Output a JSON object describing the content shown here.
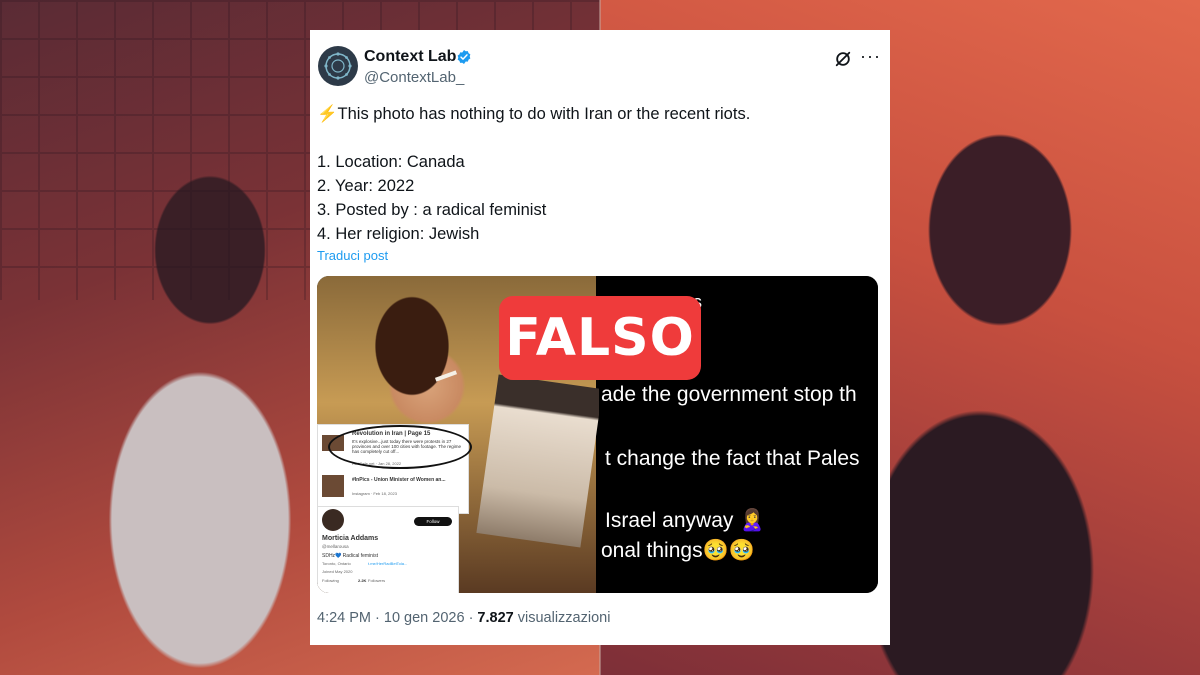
{
  "tweet": {
    "author_name": "Context Lab",
    "handle": "@ContextLab_",
    "verified_icon": "verified-badge-icon",
    "lines": [
      "⚡This photo has nothing to do with Iran or the recent riots.",
      "1. Location:  Canada",
      "2. Year:   2022",
      "3. Posted by :  a radical feminist",
      "4. Her religion:  Jewish"
    ],
    "translate_link": "Traduci post",
    "time": "4:24 PM",
    "date": "10 gen 2026",
    "views_count": "7.827",
    "views_label": "visualizzazioni"
  },
  "media_right": {
    "lines": [
      "ms",
      "ade the government stop th",
      "t change the fact that Pales",
      "Israel anyway 🙎‍♀️",
      "onal things🥹🥹"
    ]
  },
  "media_left": {
    "post1_title": "Revolution in Iran | Page 15",
    "post1_text": "It's explosive...just today there were protests in 27 provinces and over 100 cities with footage. The regime has completely cut off...",
    "post1_meta": "RedCafe.net · Jan 28, 2022",
    "post2_text": "#InPics - Union Minister of Women an...",
    "post2_meta": "Instagram · Feb 18, 2023",
    "profile_name": "Morticia Addams",
    "profile_handle": "@mellarousa",
    "profile_bio": "SDHz💙 Radical feminist",
    "profile_location": "Toronto, Ontario",
    "profile_link": "t.me/HerRadBetTola...",
    "profile_joined": "Joined May 2020",
    "profile_following": "Following",
    "profile_followers_count": "2.2K",
    "profile_followers_label": "Followers",
    "follow_button": "Follow"
  },
  "stamp": {
    "label": "FALSO",
    "color": "#ef3b3b"
  },
  "colors": {
    "link": "#1d9bf0",
    "verified": "#1d9bf0",
    "muted": "#536471"
  }
}
